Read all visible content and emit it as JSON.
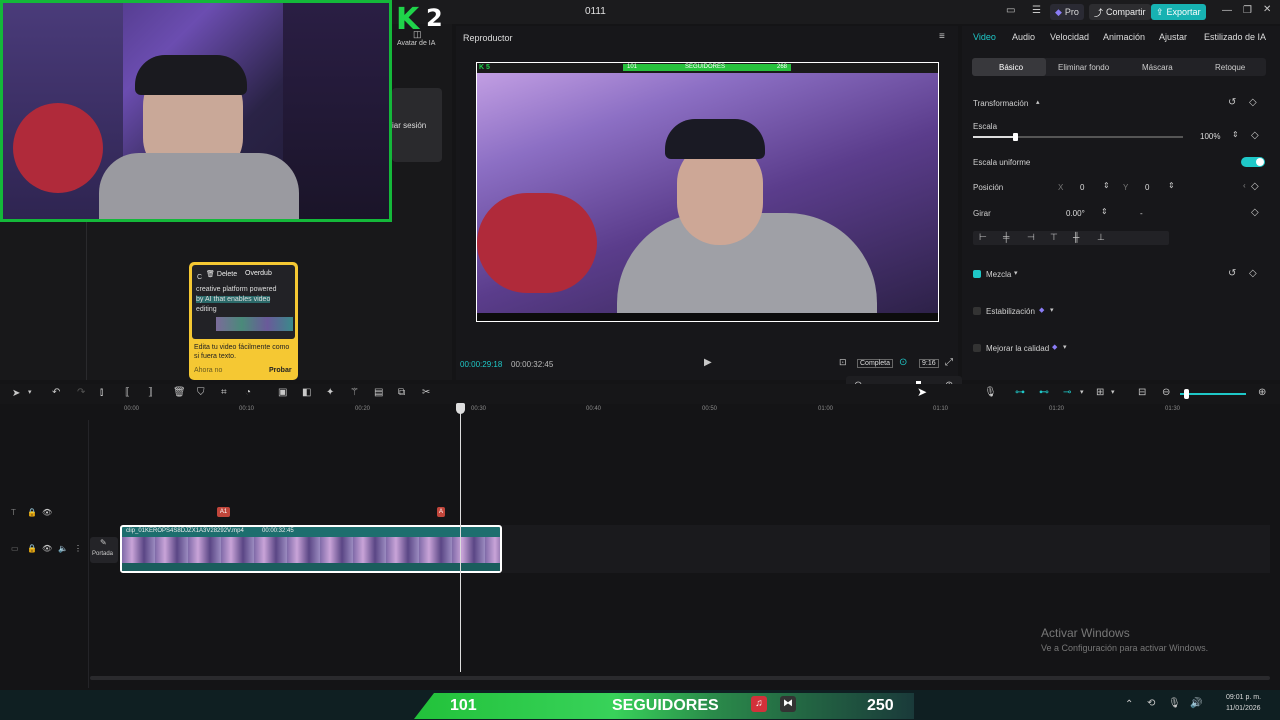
{
  "window": {
    "title": "0111",
    "pro_label": "Pro",
    "share_label": "Compartir",
    "export_label": "Exportar"
  },
  "overlay": {
    "logo_k": "K",
    "logo_num": "2",
    "ai_avatar_label": "Avatar de IA",
    "session_label": "iar sesión"
  },
  "tooltip": {
    "delete_label": "Delete",
    "overdub_label": "Overdub",
    "c_label": "C",
    "text_line1": "creative platform powered",
    "text_line2": "by AI that enables video",
    "text_line3": "editing",
    "body": "Edita tu video fácilmente como si fuera texto.",
    "later_label": "Ahora no",
    "try_label": "Probar"
  },
  "player": {
    "title": "Reproductor",
    "current_time": "00:00:29:18",
    "total_time": "00:00:32:45",
    "quality_label": "Completa",
    "ratio_label": "9:16",
    "video_bar_left": "101",
    "video_bar_center": "SEGUIDORES",
    "video_bar_right": "268",
    "video_logo": "K 5"
  },
  "inspector": {
    "tabs": [
      "Video",
      "Audio",
      "Velocidad",
      "Animación",
      "Ajustar",
      "Estilizado de IA"
    ],
    "subtabs": [
      "Básico",
      "Eliminar fondo",
      "Máscara",
      "Retoque"
    ],
    "transform_label": "Transformación",
    "scale_label": "Escala",
    "scale_value": "100%",
    "scale_level": 0.2,
    "uniform_label": "Escala uniforme",
    "position_label": "Posición",
    "pos_x_label": "X",
    "pos_x": "0",
    "pos_y_label": "Y",
    "pos_y": "0",
    "rotate_label": "Girar",
    "rotate_value": "0.00°",
    "rotate_dash": "-",
    "blend_label": "Mezcla",
    "stabilize_label": "Estabilización",
    "enhance_label": "Mejorar la calidad"
  },
  "timeline": {
    "ticks": [
      "00:00",
      "00:10",
      "00:20",
      "00:30",
      "00:40",
      "00:50",
      "01:00",
      "01:10",
      "01:20",
      "01:30"
    ],
    "clip_name": "clip_01KEROPS4S8DJZX1A3V28292V.mp4",
    "clip_duration": "00:00:32:45",
    "cover_label": "Portada",
    "marker1": "A1",
    "marker2": "A"
  },
  "watermark": {
    "line1": "Activar Windows",
    "line2": "Ve a Configuración para activar Windows."
  },
  "streambar": {
    "left_value": "101",
    "center_label": "SEGUIDORES",
    "right_value": "250"
  },
  "taskbar": {
    "time": "09:01 p. m.",
    "date": "11/01/2026"
  },
  "colors": {
    "accent": "#1fc8c8",
    "webcam_border": "#14b83a",
    "export_bg": "#17b2b2",
    "tooltip_bg": "#f5c833",
    "marker": "#c1463b"
  }
}
